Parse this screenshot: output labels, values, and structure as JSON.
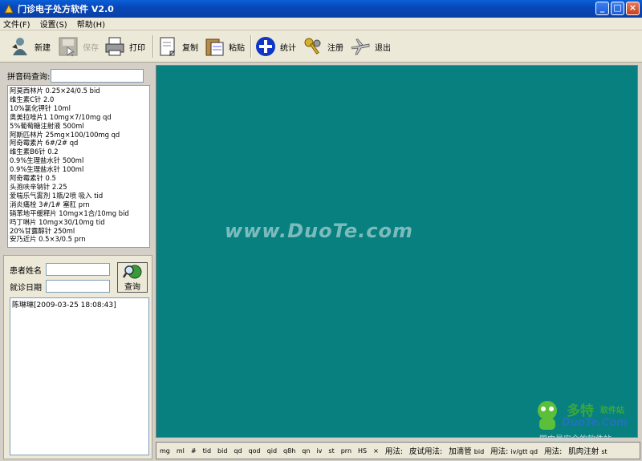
{
  "window": {
    "title": "门诊电子处方软件 V2.0",
    "buttons": {
      "minimize": "_",
      "maximize": "□",
      "close": "×"
    }
  },
  "menu": [
    "文件(F)",
    "设置(S)",
    "帮助(H)"
  ],
  "toolbar": {
    "new_label": "新建",
    "save_label": "保存",
    "print_label": "打印",
    "copy_label": "复制",
    "paste_label": "粘贴",
    "stats_label": "统计",
    "register_label": "注册",
    "exit_label": "退出"
  },
  "search": {
    "label": "拼音码查询:",
    "value": ""
  },
  "drugs": [
    "阿莫西林片 0.25×24/0.5 bid",
    "维生素C针 2.0",
    "10%氯化钾针 10ml",
    "奥美拉唑片1 10mg×7/10mg qd",
    "5%葡萄糖注射液 500ml",
    "阿斯匹林片 25mg×100/100mg qd",
    "阿奇霉素片 6#/2# qd",
    "维生素B6针 0.2",
    "0.9%生理盐水针 500ml",
    "0.9%生理盐水针 100ml",
    "阿奇霉素针 0.5",
    "头孢呋辛钠针 2.25",
    "爱喘乐气雾剂 1瓶/2喷 吸入 tid",
    "消炎痛栓 3#/1# 塞肛 prn",
    "硝苯地平缓释片 10mg×1合/10mg bid",
    "吗丁啉片 10mg×30/10mg tid",
    "20%甘露醇针 250ml",
    "安乃近片 0.5×3/0.5 prn"
  ],
  "patient": {
    "name_label": "患者姓名",
    "date_label": "就诊日期",
    "query_label": "查询",
    "records": [
      "陈琳琳[2009-03-25 18:08:43]"
    ]
  },
  "watermark": {
    "main": "www.DuoTe.com",
    "logo_cn": "多特",
    "logo_cn2": "软件站",
    "logo_en": "DuoTe.Com",
    "logo_sub": "国内最安全的软件站"
  },
  "usage_bar": {
    "abbreviations": [
      "mg",
      "ml",
      "#",
      "tid",
      "bid",
      "qd",
      "qod",
      "qid",
      "q8h",
      "qn",
      "iv",
      "st",
      "prn",
      "HS",
      "×"
    ],
    "usages": [
      {
        "label": "用法:",
        "value": ""
      },
      {
        "label": "皮试用法:",
        "value": ""
      },
      {
        "label": "加滴管",
        "value": "bid"
      },
      {
        "label": "用法:",
        "value": "iv/gtt qd"
      },
      {
        "label": "用法:",
        "value": ""
      },
      {
        "label": "肌肉注射",
        "value": "st"
      }
    ]
  }
}
